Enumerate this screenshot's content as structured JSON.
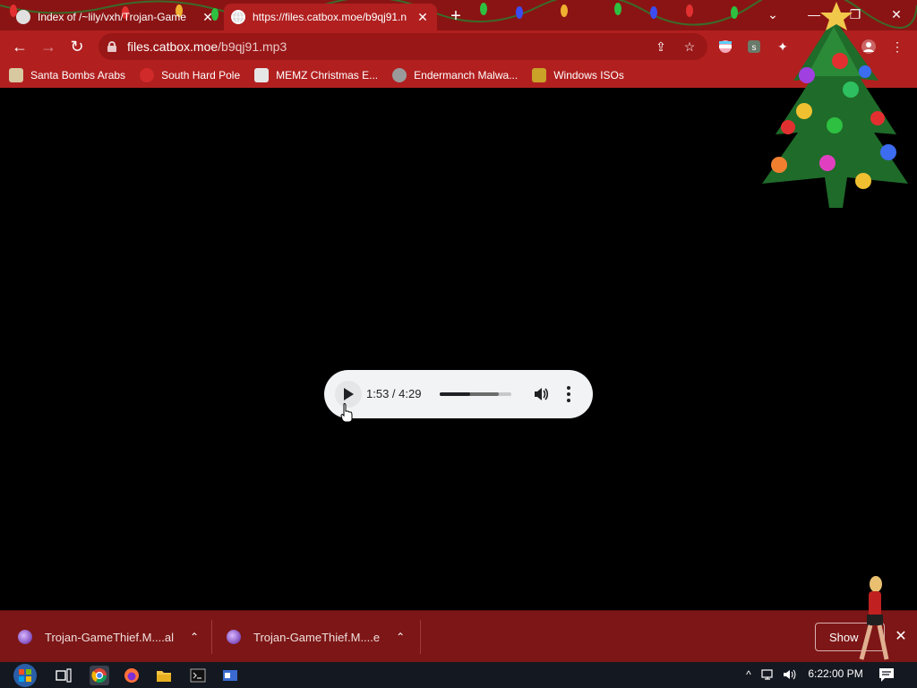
{
  "window": {
    "tabs": [
      {
        "title": "Index of /~lily/vxh/Trojan-Game",
        "close_glyph": "✕",
        "icon": "page-icon"
      },
      {
        "title": "https://files.catbox.moe/b9qj91.n",
        "close_glyph": "✕",
        "icon": "globe-icon"
      }
    ],
    "new_tab_glyph": "+",
    "controls": {
      "tab_search": "⌄",
      "minimize": "—",
      "restore": "❐",
      "close": "✕"
    }
  },
  "toolbar": {
    "url_host": "files.catbox.moe",
    "url_path": "/b9qj91.mp3",
    "back_glyph": "←",
    "forward_glyph": "→",
    "reload_glyph": "↻",
    "share_glyph": "⇪",
    "star_glyph": "☆",
    "extension_glyph": "✦",
    "menu_glyph": "⋮"
  },
  "bookmarks": [
    {
      "label": "Santa Bombs Arabs",
      "color": "#d9c9a0"
    },
    {
      "label": "South Hard Pole",
      "color": "#d12a2a"
    },
    {
      "label": "MEMZ Christmas E...",
      "color": "#e6e6e6"
    },
    {
      "label": "Endermanch Malwa...",
      "color": "#9a9a9a"
    },
    {
      "label": "Windows ISOs",
      "color": "#c9a227"
    }
  ],
  "player": {
    "time": "1:53 / 4:29",
    "progress": 0.42,
    "buffered": 0.82
  },
  "downloads": [
    {
      "label": "Trojan-GameThief.M....al",
      "chevron": "⌃"
    },
    {
      "label": "Trojan-GameThief.M....e",
      "chevron": "⌃"
    }
  ],
  "download_bar": {
    "show_label": "Show",
    "close_glyph": "✕"
  },
  "taskbar": {
    "clock": "6:22:00 PM",
    "tray_up": "^"
  },
  "colors": {
    "tabstrip": "#8a1414",
    "toolbar": "#b11f1f",
    "download_bar": "#7d1616",
    "taskbar": "#141820"
  }
}
